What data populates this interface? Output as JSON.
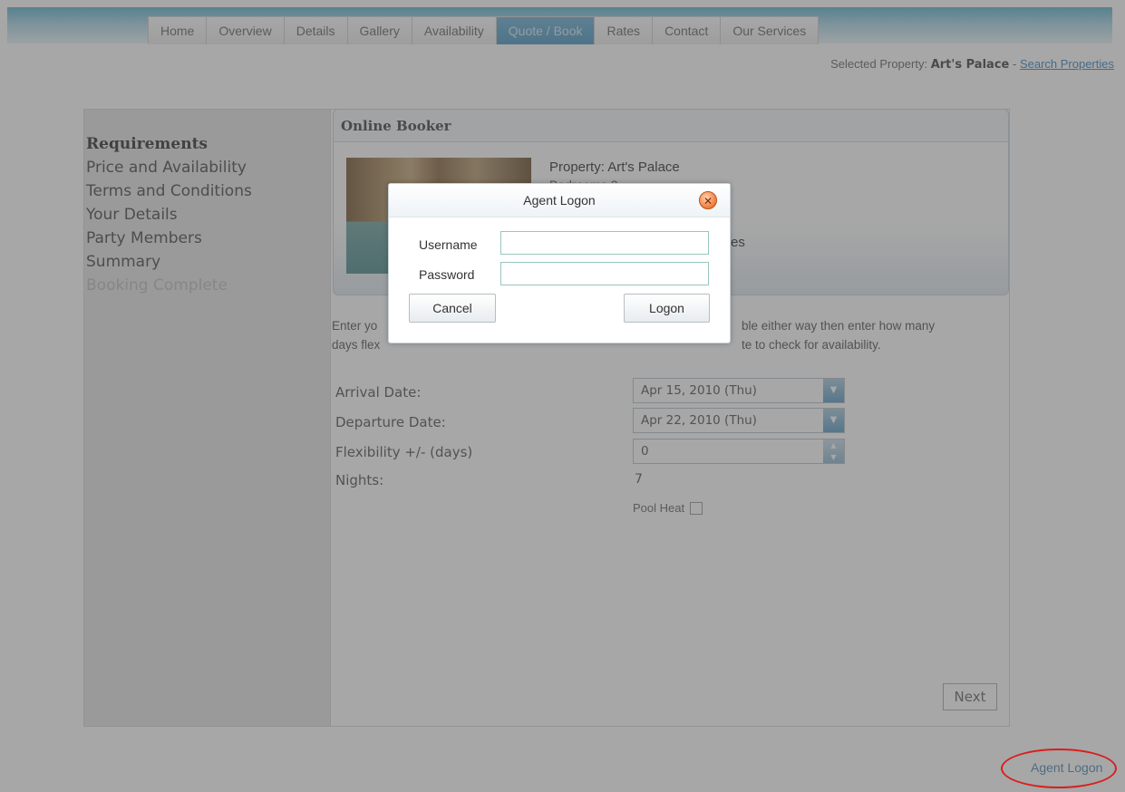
{
  "nav": {
    "tabs": [
      {
        "label": "Home"
      },
      {
        "label": "Overview"
      },
      {
        "label": "Details"
      },
      {
        "label": "Gallery"
      },
      {
        "label": "Availability"
      },
      {
        "label": "Quote / Book"
      },
      {
        "label": "Rates"
      },
      {
        "label": "Contact"
      },
      {
        "label": "Our Services"
      }
    ],
    "active_tab": "Quote / Book"
  },
  "header": {
    "selected_label": "Selected Property:",
    "selected_value": "Art's Palace",
    "separator": "-",
    "search_link": "Search Properties"
  },
  "steps": [
    {
      "label": "Requirements",
      "state": "current"
    },
    {
      "label": "Price and Availability",
      "state": "normal"
    },
    {
      "label": "Terms and Conditions",
      "state": "normal"
    },
    {
      "label": "Your Details",
      "state": "normal"
    },
    {
      "label": "Party Members",
      "state": "normal"
    },
    {
      "label": "Summary",
      "state": "normal"
    },
    {
      "label": "Booking Complete",
      "state": "disabled"
    }
  ],
  "booker": {
    "title": "Online Booker",
    "property": "Property: Art's Palace",
    "line2": "Bedrooms 3",
    "line3": "es"
  },
  "form": {
    "intro_start": "Enter yo",
    "intro_end": "ble either way then enter how many",
    "intro_line2_start": "days flex",
    "intro_line2_end": "te to check for availability.",
    "arrival_label": "Arrival Date:",
    "arrival_value": "Apr 15, 2010 (Thu)",
    "departure_label": "Departure Date:",
    "departure_value": "Apr 22, 2010 (Thu)",
    "flex_label": "Flexibility +/- (days)",
    "flex_value": "0",
    "nights_label": "Nights:",
    "nights_value": "7",
    "pool_heat_label": "Pool Heat",
    "next_label": "Next"
  },
  "footer": {
    "agent_logon": "Agent Logon"
  },
  "modal": {
    "title": "Agent Logon",
    "username_label": "Username",
    "password_label": "Password",
    "username_value": "",
    "password_value": "",
    "cancel_label": "Cancel",
    "logon_label": "Logon"
  },
  "colors": {
    "accent": "#4b97c2",
    "highlight_ring": "#d91e1e",
    "link": "#3a86c2"
  }
}
